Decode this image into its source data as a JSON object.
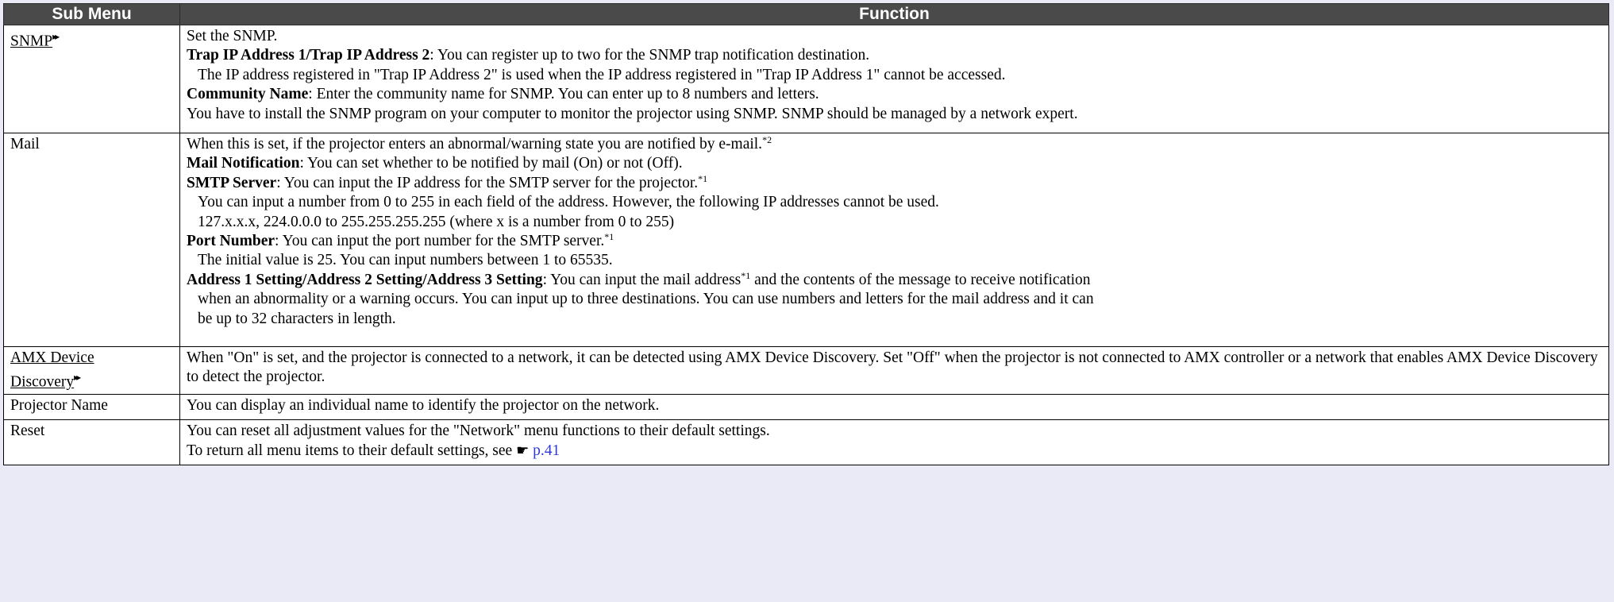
{
  "header": {
    "col1": "Sub Menu",
    "col2": "Function"
  },
  "rows": {
    "snmp": {
      "name": "SNMP",
      "name_marker": "▸▸",
      "line1": "Set the SNMP.",
      "trap_label": "Trap IP Address 1/Trap IP Address 2",
      "trap_text": ": You can register up to two for the SNMP trap notification destination.",
      "trap_note": "The IP address registered in \"Trap IP Address 2\" is used when the IP address registered in \"Trap IP Address 1\" cannot be accessed.",
      "community_label": "Community Name",
      "community_text": ": Enter the community name for SNMP.  You can enter up to 8 numbers and letters.",
      "install_text": "You have to install the SNMP program on your computer to monitor the projector using SNMP. SNMP should be managed by a network expert."
    },
    "mail": {
      "name": "Mail",
      "line1": "When this is set, if the projector enters an abnormal/warning state you are notified by e-mail.",
      "line1_sup": "*2",
      "notif_label": "Mail Notification",
      "notif_text": ": You can set whether to be notified by mail (On) or not (Off).",
      "smtp_label": "SMTP Server",
      "smtp_text": ": You can input the IP address for the SMTP server for the projector.",
      "smtp_sup": "*1",
      "smtp_note1": "You can input a number from 0 to 255 in each field of the address. However, the following IP addresses cannot be used.",
      "smtp_note2": "127.x.x.x, 224.0.0.0 to 255.255.255.255 (where x is a number from 0 to 255)",
      "port_label": "Port Number",
      "port_text": ": You can input the port number for the SMTP server.",
      "port_sup": "*1",
      "port_note": "The initial value is 25. You can input numbers between 1 to 65535.",
      "addr_label": "Address 1 Setting/Address 2 Setting/Address 3 Setting",
      "addr_text_a": ": You can input the mail address",
      "addr_sup": "*1",
      "addr_text_b": " and the contents of the message to receive notification",
      "addr_note1": "when an abnormality or a warning occurs. You can input up to three destinations. You can use numbers and letters for the mail address and it can",
      "addr_note2": "be up to 32 characters in length."
    },
    "amx": {
      "name_line1": "AMX Device",
      "name_line2": "Discovery",
      "name_marker": "▸▸",
      "text": "When \"On\" is set, and the projector is connected to a network, it can be detected using AMX Device Discovery. Set \"Off\" when the projector is not connected to AMX controller or a network that enables AMX Device Discovery to detect the projector."
    },
    "projector_name": {
      "name": "Projector Name",
      "text": "You can display an individual name to identify the projector on the network."
    },
    "reset": {
      "name": "Reset",
      "line1": "You can reset all adjustment values for the \"Network\" menu functions to their default settings.",
      "line2": "To return all menu items to their default settings, see ",
      "hand_icon": "☛",
      "link": "p.41"
    }
  }
}
